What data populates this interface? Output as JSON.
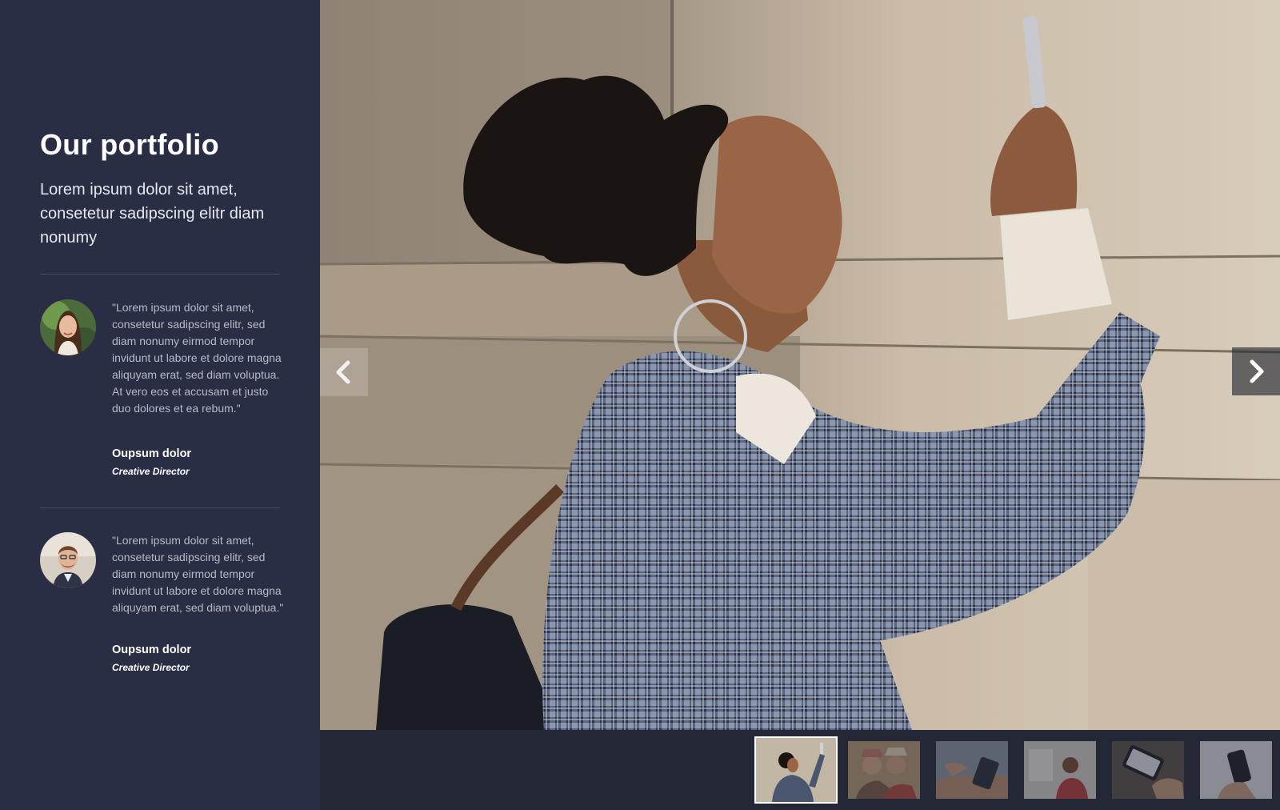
{
  "sidebar": {
    "title": "Our portfolio",
    "subtitle": "Lorem ipsum dolor sit amet, consetetur sadipscing elitr diam nonumy",
    "testimonials": [
      {
        "quote": "\"Lorem ipsum dolor sit amet, consetetur sadipscing elitr, sed diam nonumy eirmod tempor invidunt ut labore et dolore magna aliquyam erat, sed diam voluptua. At vero eos et accusam et justo duo dolores et ea rebum.\"",
        "name": "Oupsum dolor",
        "role": "Creative Director",
        "avatar_icon": "woman-avatar"
      },
      {
        "quote": "\"Lorem ipsum dolor sit amet, consetetur sadipscing elitr, sed diam nonumy eirmod tempor invidunt ut labore et dolore magna aliquyam erat, sed diam voluptua.\"",
        "name": "Oupsum dolor",
        "role": "Creative Director",
        "avatar_icon": "man-avatar"
      }
    ]
  },
  "gallery": {
    "prev_icon": "chevron-left-icon",
    "next_icon": "chevron-right-icon",
    "active_index": 0,
    "thumbnail_count": 6
  },
  "colors": {
    "sidebar_bg": "#2a2e45",
    "strip_bg": "#232736",
    "title_text": "#ffffff",
    "quote_text": "#b7bac6"
  }
}
